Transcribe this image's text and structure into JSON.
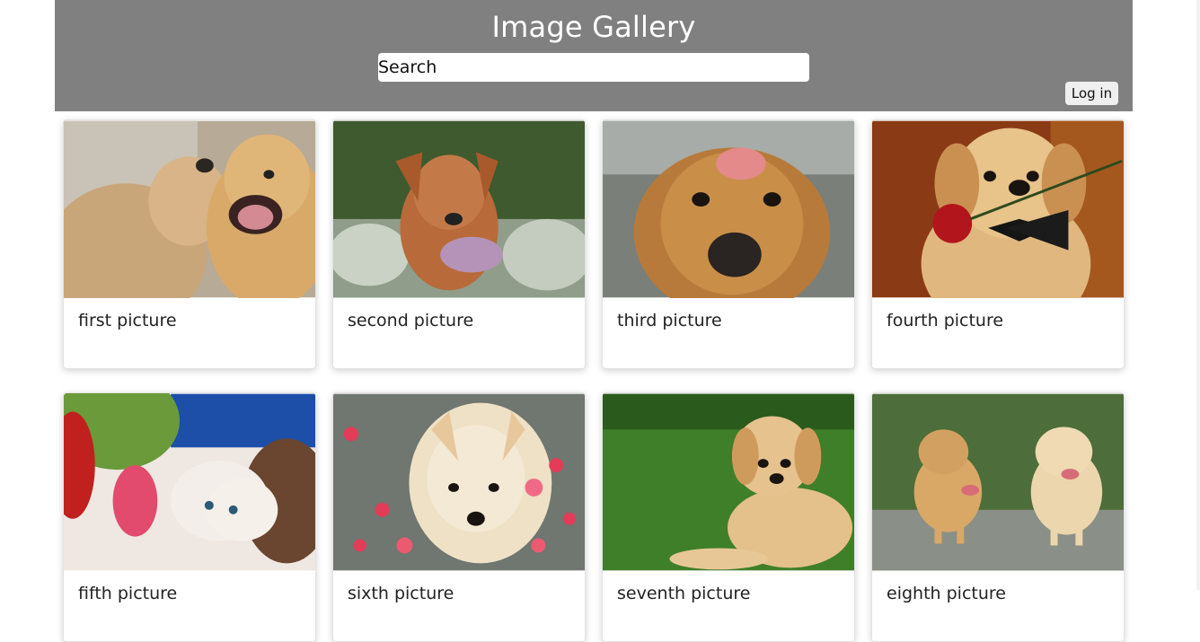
{
  "header": {
    "title": "Image Gallery",
    "search_placeholder": "Search",
    "login_label": "Log in",
    "bg_color": "#808080"
  },
  "gallery": {
    "cards": [
      {
        "caption": "first picture"
      },
      {
        "caption": "second picture"
      },
      {
        "caption": "third picture"
      },
      {
        "caption": "fourth picture"
      },
      {
        "caption": "fifth picture"
      },
      {
        "caption": "sixth picture"
      },
      {
        "caption": "seventh picture"
      },
      {
        "caption": "eighth picture"
      }
    ]
  }
}
